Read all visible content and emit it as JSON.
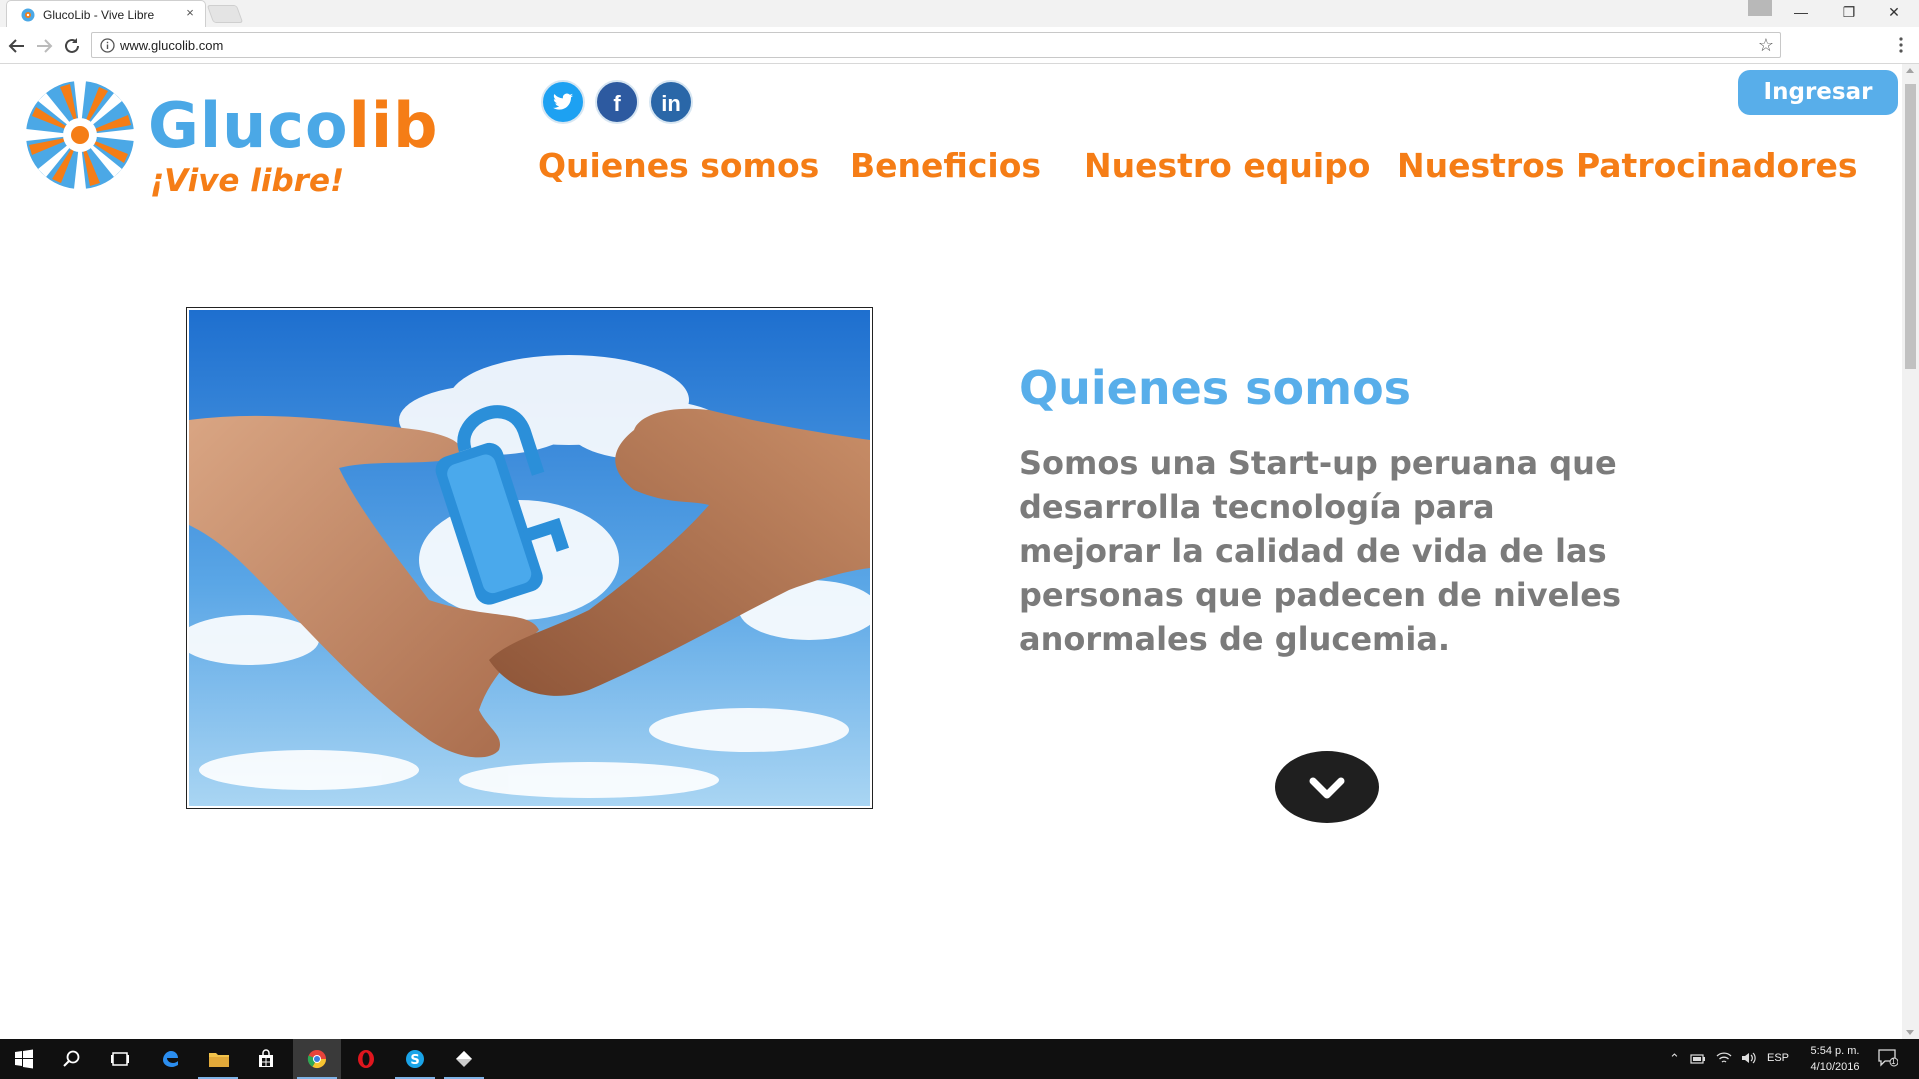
{
  "browser": {
    "tab_title": "GlucoLib - Vive Libre",
    "tab_close": "×",
    "url": "www.glucolib.com",
    "window_minimize": "—",
    "window_restore": "❐",
    "window_close": "✕"
  },
  "site": {
    "logo_text_part1": "Gluco",
    "logo_text_part2": "lib",
    "tagline": "¡Vive libre!",
    "social": {
      "twitter": "twitter-icon",
      "facebook": "f",
      "linkedin": "in"
    },
    "nav": [
      {
        "label": "Quienes somos"
      },
      {
        "label": "Beneficios"
      },
      {
        "label": "Nuestro equipo"
      },
      {
        "label": "Nuestros Patrocinadores"
      }
    ],
    "login_label": "Ingresar",
    "section_title": "Quienes somos",
    "section_body": "Somos una Start-up peruana que desarrolla tecnología para mejorar la calidad de vida de las personas que padecen de niveles anormales de glucemia."
  },
  "taskbar": {
    "language": "ESP",
    "time": "5:54 p. m.",
    "date": "4/10/2016",
    "notification_count": "1"
  },
  "colors": {
    "brand_blue": "#58aeea",
    "brand_orange": "#f57d16",
    "body_gray": "#7b7b7b"
  }
}
